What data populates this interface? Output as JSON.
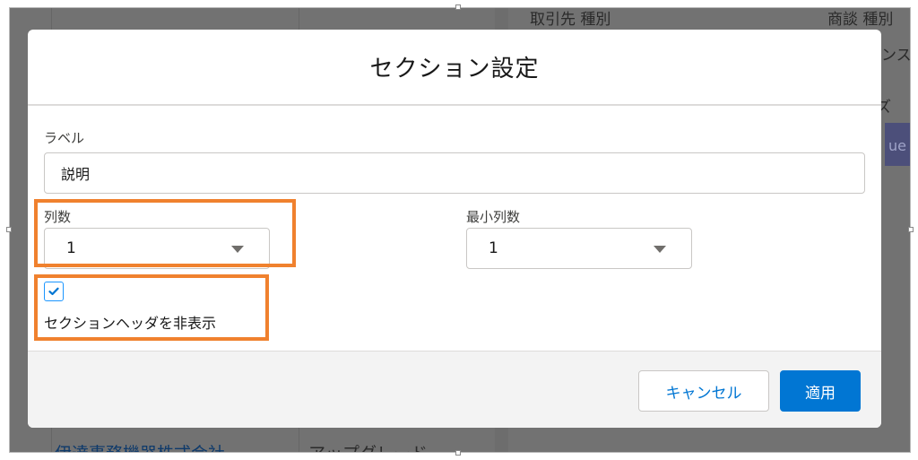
{
  "background": {
    "header_left": "取引先 種別",
    "header_right": "商談 種別",
    "right_fragment_1": "ンス",
    "right_fragment_2": "ズ",
    "right_fragment_3": "ue",
    "bottom_link": "伊達事務機器株式会社",
    "bottom_text": "アップグレード"
  },
  "modal": {
    "title": "セクション設定",
    "label_field": {
      "label": "ラベル",
      "value": "説明"
    },
    "columns_field": {
      "label": "列数",
      "value": "1"
    },
    "min_columns_field": {
      "label": "最小列数",
      "value": "1"
    },
    "hide_header_checkbox": {
      "checked": true,
      "label": "セクションヘッダを非表示"
    },
    "footer": {
      "cancel_label": "キャンセル",
      "apply_label": "適用"
    }
  },
  "colors": {
    "brand": "#0176d3",
    "highlight": "#f0812e",
    "overlay": "#727272"
  }
}
